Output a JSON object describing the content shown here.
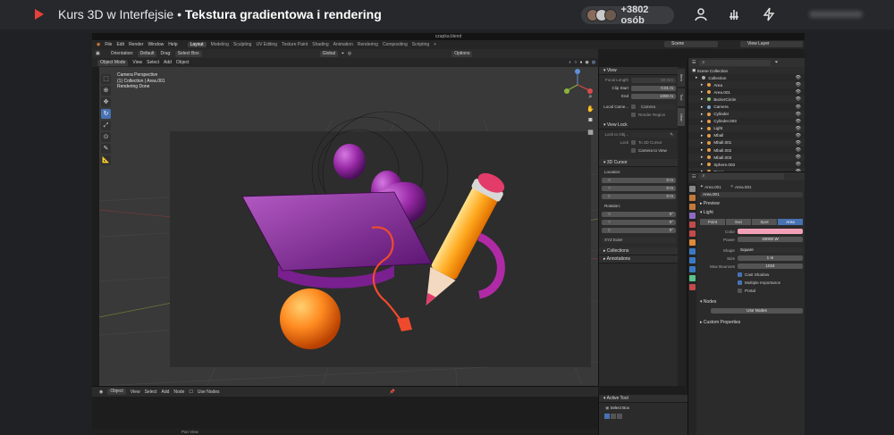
{
  "stream": {
    "course_title": "Kurs 3D w Interfejsie",
    "separator": "•",
    "lesson_title": "Tekstura gradientowa i rendering",
    "viewers": "+3802 osób"
  },
  "blender": {
    "file_title": "czapka.blend",
    "menu": [
      "File",
      "Edit",
      "Render",
      "Window",
      "Help"
    ],
    "workspaces": [
      "Layout",
      "Modeling",
      "Sculpting",
      "UV Editing",
      "Texture Paint",
      "Shading",
      "Animation",
      "Rendering",
      "Compositing",
      "Scripting"
    ],
    "active_workspace": "Layout",
    "scene": "Scene",
    "view_layer": "View Layer",
    "header": {
      "orientation_label": "Orientation:",
      "orientation_value": "Default",
      "drag_label": "Drag:",
      "drag_value": "Select Box",
      "transform": "Global",
      "options": "Options"
    },
    "viewport_menu": [
      "Object Mode",
      "View",
      "Select",
      "Add",
      "Object"
    ],
    "viewport_info": [
      "Camera Perspective",
      "(1) Collection | Area.001",
      "Rendering Done"
    ],
    "npanel": {
      "view_title": "View",
      "focal_length_label": "Focal Length",
      "focal_length": "50 mm",
      "clip_start_label": "Clip Start",
      "clip_start": "0.01 m",
      "end_label": "End",
      "end": "1000 m",
      "local_camera_label": "Local Came...",
      "local_camera": "Camera",
      "render_region": "Render Region",
      "view_lock": "View Lock",
      "lock_to_obj": "Lock to Obj...",
      "lock_label": "Lock",
      "to_3d_cursor": "To 3D Cursor",
      "camera_to_view": "Camera to View",
      "cursor_title": "3D Cursor",
      "location_label": "Location:",
      "rotation_label": "Rotation:",
      "x_label": "X",
      "y_label": "Y",
      "z_label": "Z",
      "loc": [
        "0 m",
        "0 m",
        "0 m"
      ],
      "rot": [
        "0°",
        "0°",
        "0°"
      ],
      "rotation_mode": "XYZ Euler",
      "collections": "Collections",
      "annotations": "Annotations"
    },
    "side_tabs": [
      "Item",
      "Tool",
      "View"
    ],
    "outliner": {
      "title": "Scene Collection",
      "items": [
        {
          "name": "Collection",
          "color": "#aaaaaa"
        },
        {
          "name": "Area",
          "color": "#e6a04a"
        },
        {
          "name": "Area.001",
          "color": "#e6a04a"
        },
        {
          "name": "BezierCircle",
          "color": "#8fc46a"
        },
        {
          "name": "Camera",
          "color": "#7aa8d6"
        },
        {
          "name": "Cylinder",
          "color": "#e6a04a"
        },
        {
          "name": "Cylinder.003",
          "color": "#e6a04a"
        },
        {
          "name": "Light",
          "color": "#e6a04a"
        },
        {
          "name": "Mball",
          "color": "#e6a04a"
        },
        {
          "name": "Mball.001",
          "color": "#e6a04a"
        },
        {
          "name": "Mball.002",
          "color": "#e6a04a"
        },
        {
          "name": "Mball.003",
          "color": "#e6a04a"
        },
        {
          "name": "Sphere.003",
          "color": "#e6a04a"
        },
        {
          "name": "Torus",
          "color": "#e6a04a"
        }
      ]
    },
    "properties": {
      "object": "Area.001",
      "data": "Area.001",
      "datablock": "Area.001",
      "preview": "Preview",
      "light_title": "Light",
      "light_types": [
        "Point",
        "Sun",
        "Spot",
        "Area"
      ],
      "active_light_type": "Area",
      "color_label": "Color",
      "color_value": "#f2a0b8",
      "power_label": "Power",
      "power": "20000 W",
      "shape_label": "Shape",
      "shape": "Square",
      "size_label": "Size",
      "size": "1 m",
      "max_bounces_label": "Max Bounces",
      "max_bounces": "1024",
      "cast_shadow": "Cast Shadow",
      "multiple_importance": "Multiple Importance",
      "portal": "Portal",
      "nodes_title": "Nodes",
      "use_nodes": "Use Nodes",
      "custom_properties": "Custom Properties"
    },
    "node_editor": {
      "menu": [
        "Object",
        "View",
        "Select",
        "Add",
        "Node"
      ],
      "use_nodes": "Use Nodes"
    },
    "active_tool": {
      "title": "Active Tool",
      "select_box": "Select Box"
    },
    "status": "Pan View"
  }
}
